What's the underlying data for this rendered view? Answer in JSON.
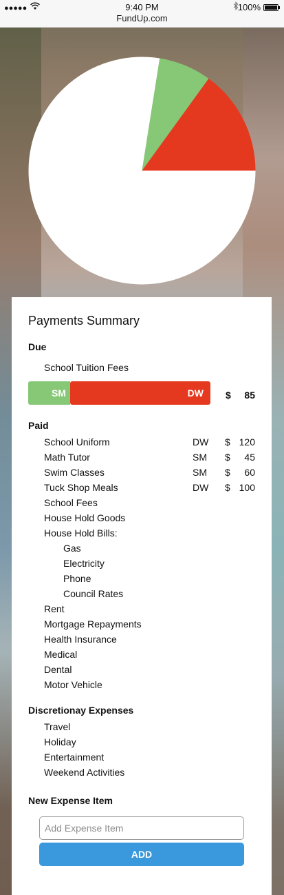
{
  "status_bar": {
    "signal": "●●●●●",
    "wifi_icon": "wifi-icon",
    "time": "9:40 PM",
    "url": "FundUp.com",
    "bluetooth_icon": "bluetooth-icon",
    "battery_percent": "100%",
    "battery_level": 1.0
  },
  "chart_data": {
    "type": "pie",
    "slices": [
      {
        "label": "White",
        "value": 77.5,
        "color": "#ffffff"
      },
      {
        "label": "Green",
        "value": 7.5,
        "color": "#86c875"
      },
      {
        "label": "Red",
        "value": 15.0,
        "color": "#e5391f"
      }
    ],
    "start_angle_deg": 0
  },
  "summary": {
    "title": "Payments Summary",
    "due": {
      "heading": "Due",
      "item": "School Tuition Fees",
      "bar": {
        "sm_label": "SM",
        "dw_label": "DW",
        "sm_fraction": 0.23,
        "sm_color": "#86c875",
        "dw_color": "#e5391f"
      },
      "currency": "$",
      "amount": "85"
    },
    "paid": {
      "heading": "Paid",
      "items": [
        {
          "label": "School Uniform",
          "initials": "DW",
          "currency": "$",
          "amount": "120"
        },
        {
          "label": "Math Tutor",
          "initials": "SM",
          "currency": "$",
          "amount": "45"
        },
        {
          "label": "Swim Classes",
          "initials": "SM",
          "currency": "$",
          "amount": "60"
        },
        {
          "label": "Tuck Shop Meals",
          "initials": "DW",
          "currency": "$",
          "amount": "100"
        },
        {
          "label": "School Fees"
        },
        {
          "label": "House Hold Goods"
        },
        {
          "label": "House Hold Bills:"
        },
        {
          "label": "Gas"
        },
        {
          "label": "Electricity"
        },
        {
          "label": "Phone"
        },
        {
          "label": "Council Rates"
        },
        {
          "label": "Rent"
        },
        {
          "label": "Mortgage Repayments"
        },
        {
          "label": "Health Insurance"
        },
        {
          "label": "Medical"
        },
        {
          "label": "Dental"
        },
        {
          "label": "Motor Vehicle"
        }
      ]
    },
    "discretionary": {
      "heading": "Discretionay Expenses",
      "items": [
        "Travel",
        "Holiday",
        "Entertainment",
        "Weekend Activities"
      ]
    },
    "new_expense": {
      "heading": "New Expense Item",
      "placeholder": "Add Expense Item",
      "add_label": "ADD"
    }
  }
}
